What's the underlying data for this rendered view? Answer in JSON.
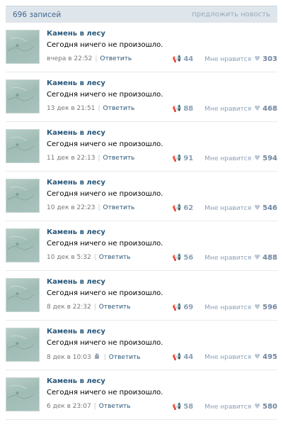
{
  "header": {
    "records": "696 записей",
    "suggest": "предложить новость"
  },
  "posts": [
    {
      "author": "Камень в лесу",
      "text": "Сегодня ничего не произошло.",
      "date": "вчера в 22:52",
      "reply": "Ответить",
      "shares": "44",
      "like_label": "Мне нравится",
      "likes": "303",
      "device": ""
    },
    {
      "author": "Камень в лесу",
      "text": "Сегодня ничего не произошло.",
      "date": "13 дек в 21:51",
      "reply": "Ответить",
      "shares": "88",
      "like_label": "Мне нравится",
      "likes": "468",
      "device": ""
    },
    {
      "author": "Камень в лесу",
      "text": "Сегодня ничего не произошло.",
      "date": "11 дек в 22:13",
      "reply": "Ответить",
      "shares": "91",
      "like_label": "Мне нравится",
      "likes": "594",
      "device": ""
    },
    {
      "author": "Камень в лесу",
      "text": "Сегодня ничего не произошло.",
      "date": "10 дек в 22:23",
      "reply": "Ответить",
      "shares": "62",
      "like_label": "Мне нравится",
      "likes": "546",
      "device": ""
    },
    {
      "author": "Камень в лесу",
      "text": "Сегодня ничего не произошло.",
      "date": "10 дек в 5:32",
      "reply": "Ответить",
      "shares": "56",
      "like_label": "Мне нравится",
      "likes": "488",
      "device": ""
    },
    {
      "author": "Камень в лесу",
      "text": "Сегодня ничего не произошло.",
      "date": "8 дек в 22:32",
      "reply": "Ответить",
      "shares": "69",
      "like_label": "Мне нравится",
      "likes": "596",
      "device": ""
    },
    {
      "author": "Камень в лесу",
      "text": "Сегодня ничего не произошло.",
      "date": "8 дек в 10:03",
      "reply": "Ответить",
      "shares": "44",
      "like_label": "Мне нравится",
      "likes": "495",
      "device": "android-icon"
    },
    {
      "author": "Камень в лесу",
      "text": "Сегодня ничего не произошло.",
      "date": "6 дек в 23:07",
      "reply": "Ответить",
      "shares": "58",
      "like_label": "Мне нравится",
      "likes": "580",
      "device": ""
    }
  ],
  "colors": {
    "header_bg": "#dee5eb",
    "link": "#2b587a",
    "muted_blue": "#8aa0b6"
  },
  "icons": {
    "share": "megaphone-icon",
    "like": "heart-icon",
    "device": "android-icon"
  }
}
